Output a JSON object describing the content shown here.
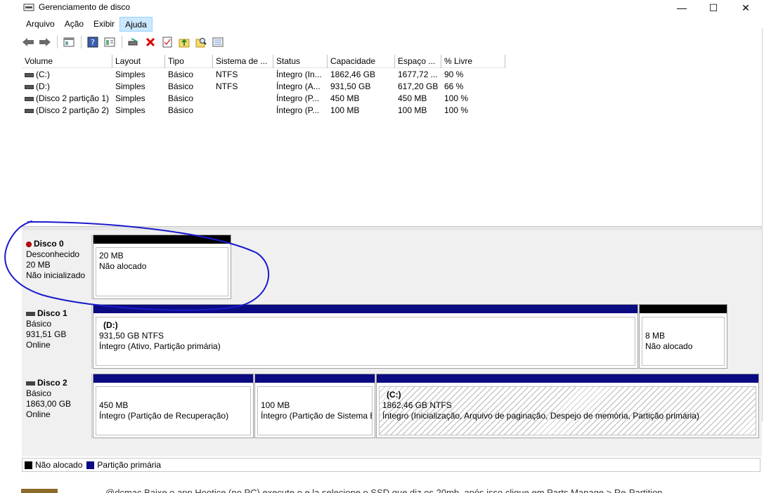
{
  "window": {
    "title": "Gerenciamento de disco",
    "minimize": "—",
    "maximize": "☐",
    "close": "✕"
  },
  "menu": [
    "Arquivo",
    "Ação",
    "Exibir",
    "Ajuda"
  ],
  "toolbar": [
    "back-icon",
    "forward-icon",
    "console-tree-icon",
    "help-icon",
    "properties-icon",
    "connect-disk-icon",
    "delete-icon",
    "check-icon",
    "import-icon",
    "find-icon",
    "view-icon"
  ],
  "list": {
    "columns": [
      "Volume",
      "Layout",
      "Tipo",
      "Sistema de ...",
      "Status",
      "Capacidade",
      "Espaço ...",
      "% Livre"
    ],
    "rows": [
      [
        "(C:)",
        "Simples",
        "Básico",
        "NTFS",
        "Íntegro (In...",
        "1862,46 GB",
        "1677,72 ...",
        "90 %"
      ],
      [
        "(D:)",
        "Simples",
        "Básico",
        "NTFS",
        "Íntegro (A...",
        "931,50 GB",
        "617,20 GB",
        "66 %"
      ],
      [
        "(Disco 2 partição 1)",
        "Simples",
        "Básico",
        "",
        "Íntegro (P...",
        "450 MB",
        "450 MB",
        "100 %"
      ],
      [
        "(Disco 2 partição 2)",
        "Simples",
        "Básico",
        "",
        "Íntegro (P...",
        "100 MB",
        "100 MB",
        "100 %"
      ]
    ]
  },
  "disks": {
    "disk0": {
      "name": "Disco 0",
      "type": "Desconhecido",
      "size": "20 MB",
      "state": "Não inicializado",
      "part": {
        "line1": "20 MB",
        "line2": "Não alocado"
      }
    },
    "disk1": {
      "name": "Disco 1",
      "type": "Básico",
      "size": "931,51 GB",
      "state": "Online",
      "part1": {
        "name": "(D:)",
        "line1": "931,50 GB NTFS",
        "line2": "Íntegro (Ativo, Partição primária)"
      },
      "part2": {
        "line1": "8 MB",
        "line2": "Não alocado"
      }
    },
    "disk2": {
      "name": "Disco 2",
      "type": "Básico",
      "size": "1863,00 GB",
      "state": "Online",
      "part1": {
        "line1": "450 MB",
        "line2": "Íntegro (Partição de Recuperação)"
      },
      "part2": {
        "line1": "100 MB",
        "line2": "Íntegro (Partição de Sistema E"
      },
      "part3": {
        "name": "(C:)",
        "line1": "1862,46 GB NTFS",
        "line2": "Íntegro (Inicialização, Arquivo de paginação, Despejo de memória, Partição primária)"
      }
    }
  },
  "legend": {
    "unallocated": "Não alocado",
    "primary": "Partição primária"
  },
  "bottom_text": "@dcmac  Baixe o app Hootice (no PC) execute o e la selecione o SSD que diz os 20mb, após isso clique em Parts Manage > Re-Partition",
  "colors": {
    "unallocated": "#000000",
    "primary": "#0a0a82",
    "annotation": "#1a1acc"
  }
}
